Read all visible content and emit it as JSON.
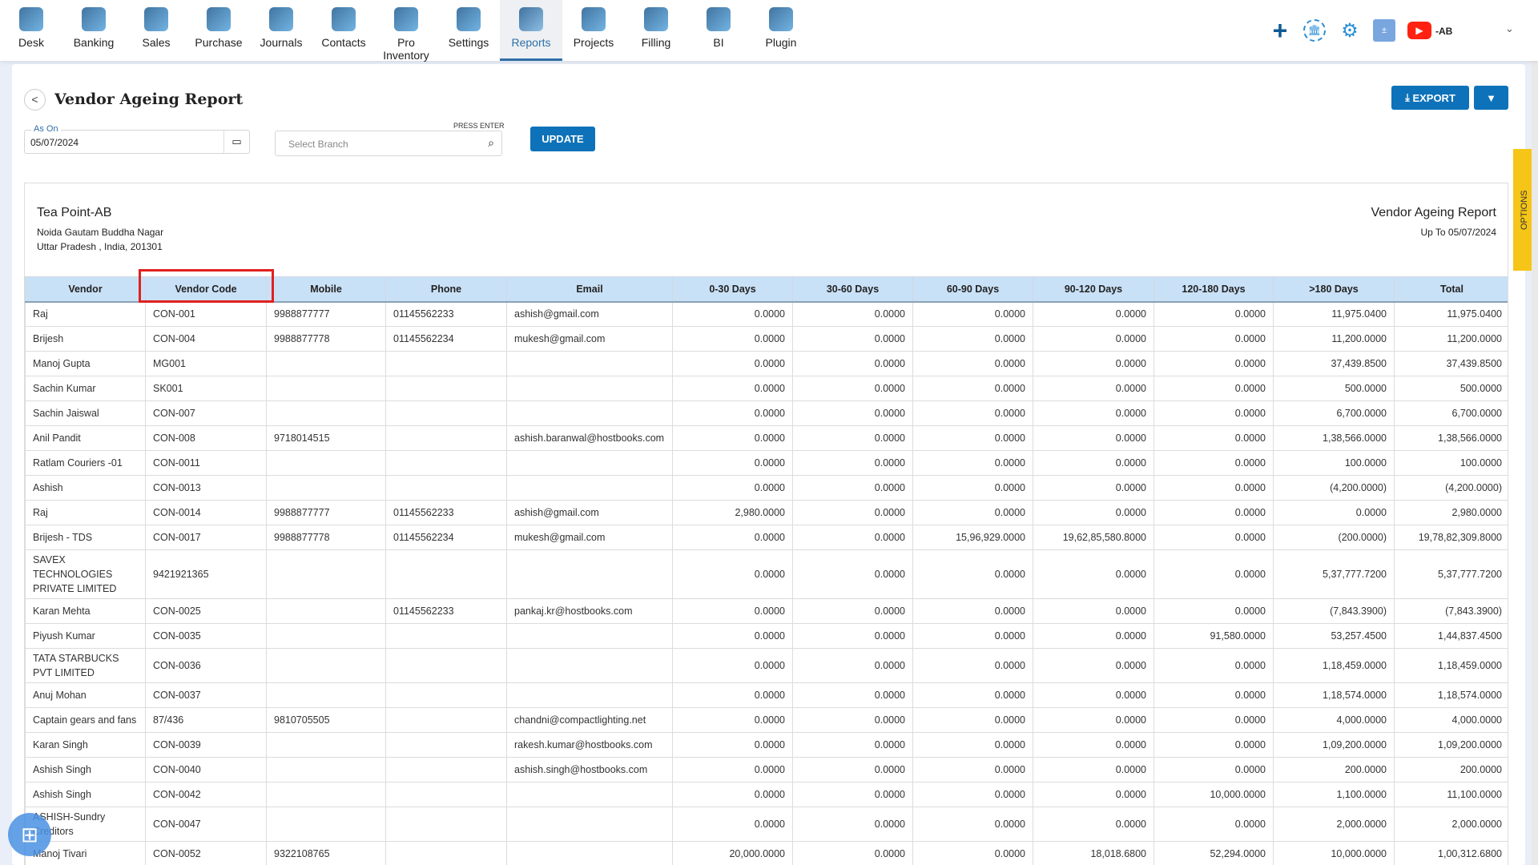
{
  "nav": {
    "items": [
      {
        "label": "Desk",
        "icon": "desk-icon"
      },
      {
        "label": "Banking",
        "icon": "bank-icon"
      },
      {
        "label": "Sales",
        "icon": "sales-icon"
      },
      {
        "label": "Purchase",
        "icon": "purchase-icon"
      },
      {
        "label": "Journals",
        "icon": "journals-icon"
      },
      {
        "label": "Contacts",
        "icon": "contacts-icon"
      },
      {
        "label": "Pro Inventory",
        "icon": "inventory-icon"
      },
      {
        "label": "Settings",
        "icon": "settings-icon"
      },
      {
        "label": "Reports",
        "icon": "reports-icon",
        "active": true
      },
      {
        "label": "Projects",
        "icon": "projects-icon"
      },
      {
        "label": "Filling",
        "icon": "filling-icon"
      },
      {
        "label": "BI",
        "icon": "bi-icon"
      },
      {
        "label": "Plugin",
        "icon": "plugin-icon"
      }
    ],
    "user": "-AB"
  },
  "page": {
    "title": "Vendor Ageing Report",
    "export_label": "EXPORT",
    "as_on_label": "As On",
    "as_on_value": "05/07/2024",
    "branch_placeholder": "Select Branch",
    "press_enter": "PRESS ENTER",
    "update_label": "UPDATE",
    "options_label": "OPTIONS"
  },
  "report": {
    "company": "Tea Point-AB",
    "address1": "Noida Gautam Buddha Nagar",
    "address2": "Uttar Pradesh , India, 201301",
    "title": "Vendor Ageing Report",
    "subtitle": "Up To 05/07/2024"
  },
  "colors": {
    "accent": "#0d72b9",
    "header_bg": "#c9e1f7",
    "highlight": "#e02020",
    "options_tab": "#f5c518"
  },
  "table": {
    "columns": [
      "Vendor",
      "Vendor Code",
      "Mobile",
      "Phone",
      "Email",
      "0-30 Days",
      "30-60 Days",
      "60-90 Days",
      "90-120 Days",
      "120-180 Days",
      ">180 Days",
      "Total"
    ],
    "rows": [
      [
        "Raj",
        "CON-001",
        "9988877777",
        "01145562233",
        "ashish@gmail.com",
        "0.0000",
        "0.0000",
        "0.0000",
        "0.0000",
        "0.0000",
        "11,975.0400",
        "11,975.0400"
      ],
      [
        "Brijesh",
        "CON-004",
        "9988877778",
        "01145562234",
        "mukesh@gmail.com",
        "0.0000",
        "0.0000",
        "0.0000",
        "0.0000",
        "0.0000",
        "11,200.0000",
        "11,200.0000"
      ],
      [
        "Manoj Gupta",
        "MG001",
        "",
        "",
        "",
        "0.0000",
        "0.0000",
        "0.0000",
        "0.0000",
        "0.0000",
        "37,439.8500",
        "37,439.8500"
      ],
      [
        "Sachin Kumar",
        "SK001",
        "",
        "",
        "",
        "0.0000",
        "0.0000",
        "0.0000",
        "0.0000",
        "0.0000",
        "500.0000",
        "500.0000"
      ],
      [
        "Sachin Jaiswal",
        "CON-007",
        "",
        "",
        "",
        "0.0000",
        "0.0000",
        "0.0000",
        "0.0000",
        "0.0000",
        "6,700.0000",
        "6,700.0000"
      ],
      [
        "Anil Pandit",
        "CON-008",
        "9718014515",
        "",
        "ashish.baranwal@hostbooks.com",
        "0.0000",
        "0.0000",
        "0.0000",
        "0.0000",
        "0.0000",
        "1,38,566.0000",
        "1,38,566.0000"
      ],
      [
        "Ratlam Couriers -01",
        "CON-0011",
        "",
        "",
        "",
        "0.0000",
        "0.0000",
        "0.0000",
        "0.0000",
        "0.0000",
        "100.0000",
        "100.0000"
      ],
      [
        "Ashish",
        "CON-0013",
        "",
        "",
        "",
        "0.0000",
        "0.0000",
        "0.0000",
        "0.0000",
        "0.0000",
        "(4,200.0000)",
        "(4,200.0000)"
      ],
      [
        "Raj",
        "CON-0014",
        "9988877777",
        "01145562233",
        "ashish@gmail.com",
        "2,980.0000",
        "0.0000",
        "0.0000",
        "0.0000",
        "0.0000",
        "0.0000",
        "2,980.0000"
      ],
      [
        "Brijesh - TDS",
        "CON-0017",
        "9988877778",
        "01145562234",
        "mukesh@gmail.com",
        "0.0000",
        "0.0000",
        "15,96,929.0000",
        "19,62,85,580.8000",
        "0.0000",
        "(200.0000)",
        "19,78,82,309.8000"
      ],
      [
        "SAVEX TECHNOLOGIES PRIVATE LIMITED",
        "9421921365",
        "",
        "",
        "",
        "0.0000",
        "0.0000",
        "0.0000",
        "0.0000",
        "0.0000",
        "5,37,777.7200",
        "5,37,777.7200"
      ],
      [
        "Karan Mehta",
        "CON-0025",
        "",
        "01145562233",
        "pankaj.kr@hostbooks.com",
        "0.0000",
        "0.0000",
        "0.0000",
        "0.0000",
        "0.0000",
        "(7,843.3900)",
        "(7,843.3900)"
      ],
      [
        "Piyush Kumar",
        "CON-0035",
        "",
        "",
        "",
        "0.0000",
        "0.0000",
        "0.0000",
        "0.0000",
        "91,580.0000",
        "53,257.4500",
        "1,44,837.4500"
      ],
      [
        "TATA STARBUCKS PVT LIMITED",
        "CON-0036",
        "",
        "",
        "",
        "0.0000",
        "0.0000",
        "0.0000",
        "0.0000",
        "0.0000",
        "1,18,459.0000",
        "1,18,459.0000"
      ],
      [
        "Anuj Mohan",
        "CON-0037",
        "",
        "",
        "",
        "0.0000",
        "0.0000",
        "0.0000",
        "0.0000",
        "0.0000",
        "1,18,574.0000",
        "1,18,574.0000"
      ],
      [
        "Captain gears and fans",
        "87/436",
        "9810705505",
        "",
        "chandni@compactlighting.net",
        "0.0000",
        "0.0000",
        "0.0000",
        "0.0000",
        "0.0000",
        "4,000.0000",
        "4,000.0000"
      ],
      [
        "Karan Singh",
        "CON-0039",
        "",
        "",
        "rakesh.kumar@hostbooks.com",
        "0.0000",
        "0.0000",
        "0.0000",
        "0.0000",
        "0.0000",
        "1,09,200.0000",
        "1,09,200.0000"
      ],
      [
        "Ashish Singh",
        "CON-0040",
        "",
        "",
        "ashish.singh@hostbooks.com",
        "0.0000",
        "0.0000",
        "0.0000",
        "0.0000",
        "0.0000",
        "200.0000",
        "200.0000"
      ],
      [
        "Ashish Singh",
        "CON-0042",
        "",
        "",
        "",
        "0.0000",
        "0.0000",
        "0.0000",
        "0.0000",
        "10,000.0000",
        "1,100.0000",
        "11,100.0000"
      ],
      [
        "ASHISH-Sundry Creditors",
        "CON-0047",
        "",
        "",
        "",
        "0.0000",
        "0.0000",
        "0.0000",
        "0.0000",
        "0.0000",
        "2,000.0000",
        "2,000.0000"
      ],
      [
        "Manoj Tivari",
        "CON-0052",
        "9322108765",
        "",
        "",
        "20,000.0000",
        "0.0000",
        "0.0000",
        "18,018.6800",
        "52,294.0000",
        "10,000.0000",
        "1,00,312.6800"
      ]
    ]
  }
}
